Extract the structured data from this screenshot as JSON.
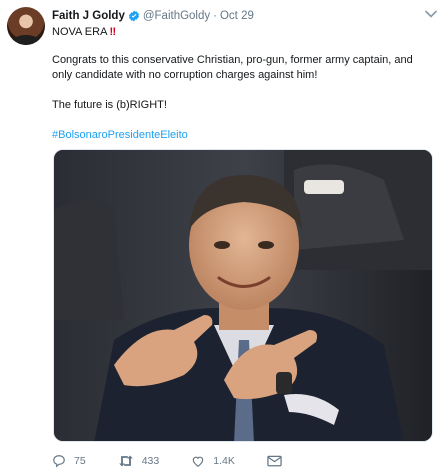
{
  "tweet": {
    "author_name": "Faith J Goldy",
    "handle": "@FaithGoldy",
    "separator": "·",
    "date": "Oct 29",
    "line1": "NOVA ERA",
    "line1_emoji": "‼",
    "paragraph": "Congrats to this conservative Christian, pro-gun, former army captain, and only candidate with no corruption charges against him!",
    "line3": "The future is (b)RIGHT!",
    "hashtag": "#BolsonaroPresidenteEleito"
  },
  "actions": {
    "reply_count": "75",
    "retweet_count": "433",
    "like_count": "1.4K"
  },
  "icons": {
    "verified": "verified-badge-icon",
    "caret": "chevron-down-icon",
    "reply": "reply-icon",
    "retweet": "retweet-icon",
    "like": "heart-icon",
    "dm": "envelope-icon"
  },
  "colors": {
    "link": "#1da1f2",
    "muted": "#657786",
    "text": "#14171a",
    "emoji_red": "#d0021b"
  }
}
